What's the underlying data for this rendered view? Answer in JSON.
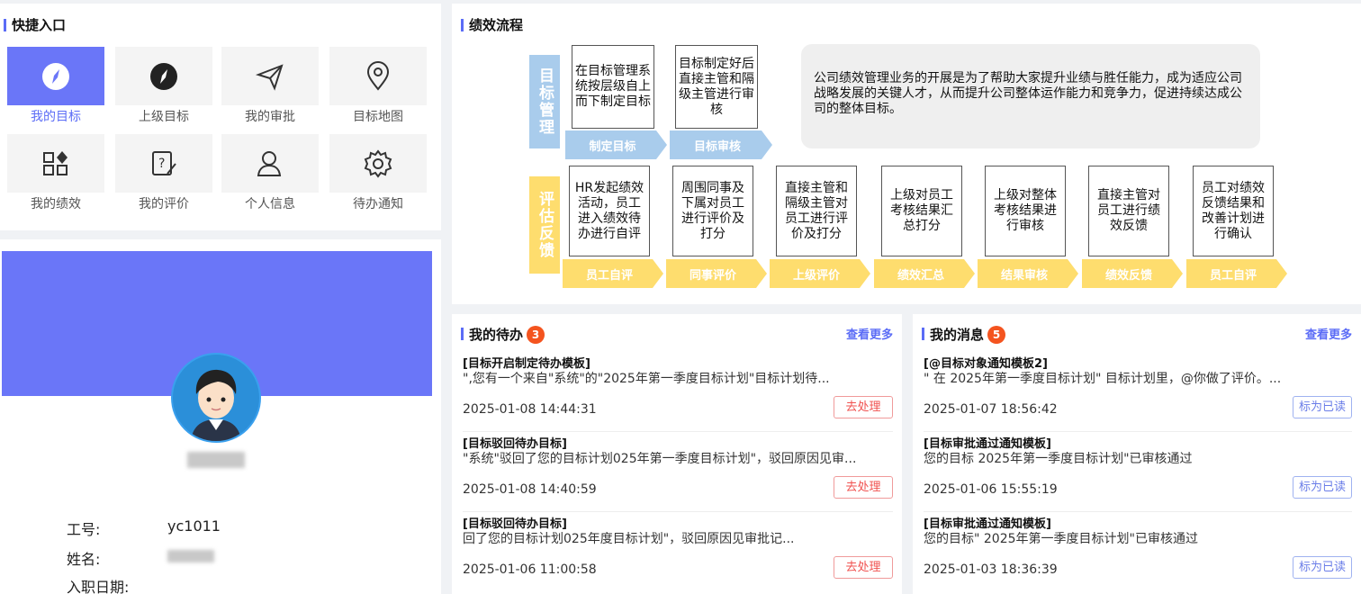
{
  "quick": {
    "title": "快捷入口",
    "items": [
      {
        "label": "我的目标",
        "icon": "compass-icon",
        "active": true
      },
      {
        "label": "上级目标",
        "icon": "compass-icon"
      },
      {
        "label": "我的审批",
        "icon": "send-icon"
      },
      {
        "label": "目标地图",
        "icon": "map-pin-icon"
      },
      {
        "label": "我的绩效",
        "icon": "grid-icon"
      },
      {
        "label": "我的评价",
        "icon": "edit-note-icon"
      },
      {
        "label": "个人信息",
        "icon": "user-icon"
      },
      {
        "label": "待办通知",
        "icon": "gear-icon"
      }
    ]
  },
  "profile": {
    "id_label": "工号:",
    "id_value": "yc1011",
    "name_label": "姓名:",
    "join_label": "入职日期:"
  },
  "flow": {
    "title": "绩效流程",
    "side_a": "目标管理",
    "side_b": "评估反馈",
    "row1_boxes": [
      "在目标管理系统按层级自上而下制定目标",
      "目标制定好后直接主管和隔级主管进行审核"
    ],
    "row1_arrows": [
      "制定目标",
      "目标审核"
    ],
    "description": "公司绩效管理业务的开展是为了帮助大家提升业绩与胜任能力，成为适应公司战略发展的关键人才，从而提升公司整体运作能力和竞争力，促进持续达成公司的整体目标。",
    "row2_boxes": [
      "HR发起绩效活动，员工进入绩效待办进行自评",
      "周围同事及下属对员工进行评价及打分",
      "直接主管和隔级主管对员工进行评价及打分",
      "上级对员工考核结果汇总打分",
      "上级对整体考核结果进行审核",
      "直接主管对员工进行绩效反馈",
      "员工对绩效反馈结果和改善计划进行确认"
    ],
    "row2_arrows": [
      "员工自评",
      "同事评价",
      "上级评价",
      "绩效汇总",
      "结果审核",
      "绩效反馈",
      "员工自评"
    ]
  },
  "todo": {
    "title": "我的待办",
    "count": "3",
    "more": "查看更多",
    "items": [
      {
        "title": "[目标开启制定待办模板]",
        "sub": "\",您有一个来自\"系统\"的\"2025年第一季度目标计划\"目标计划待...",
        "time": "2025-01-08 14:44:31",
        "btn": "去处理"
      },
      {
        "title": "[目标驳回待办目标]",
        "sub": "\"系统\"驳回了您的目标计划025年第一季度目标计划\"，驳回原因见审...",
        "time": "2025-01-08 14:40:59",
        "btn": "去处理"
      },
      {
        "title": "[目标驳回待办目标]",
        "sub": "回了您的目标计划025年度目标计划\"，驳回原因见审批记...",
        "time": "2025-01-06 11:00:58",
        "btn": "去处理"
      }
    ]
  },
  "messages": {
    "title": "我的消息",
    "count": "5",
    "more": "查看更多",
    "items": [
      {
        "title": "[@目标对象通知模板2]",
        "sub": "\" 在 2025年第一季度目标计划\" 目标计划里，@你做了评价。...",
        "time": "2025-01-07 18:56:42",
        "btn": "标为已读"
      },
      {
        "title": "[目标审批通过通知模板]",
        "sub": "您的目标 2025年第一季度目标计划\"已审核通过",
        "time": "2025-01-06 15:55:19",
        "btn": "标为已读"
      },
      {
        "title": "[目标审批通过通知模板]",
        "sub": "您的目标\" 2025年第一季度目标计划\"已审核通过",
        "time": "2025-01-03 18:36:39",
        "btn": "标为已读"
      }
    ]
  },
  "colors": {
    "accent": "#6a76f8",
    "flow_blue": "#a9ccec",
    "flow_yellow": "#fedd6e",
    "badge": "#f4541f"
  }
}
